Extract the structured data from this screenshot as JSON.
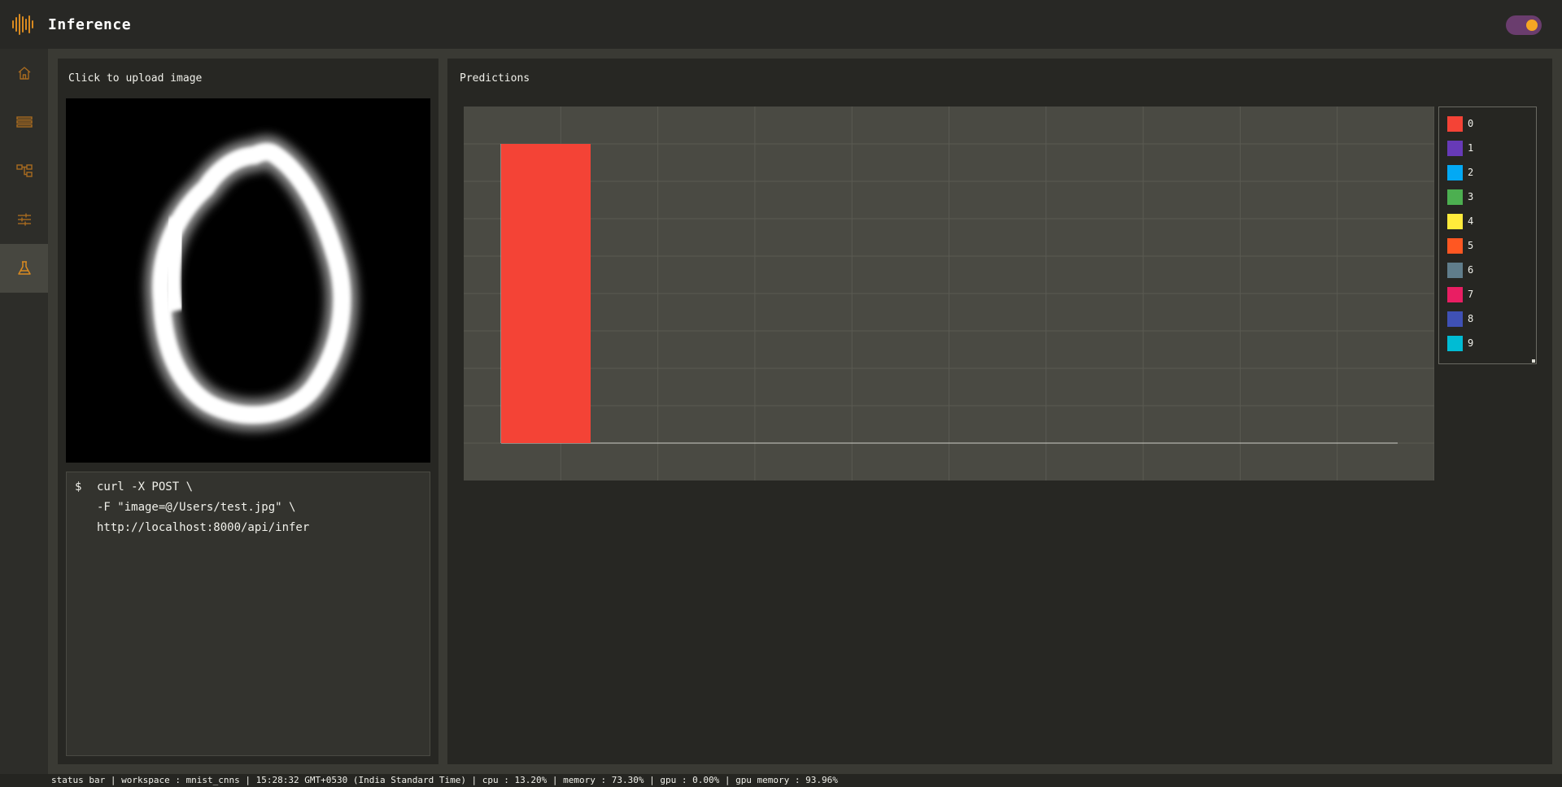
{
  "header": {
    "title": "Inference",
    "theme_toggle_on": true
  },
  "sidebar": {
    "items": [
      {
        "icon": "home-icon"
      },
      {
        "icon": "list-icon"
      },
      {
        "icon": "hierarchy-icon"
      },
      {
        "icon": "sliders-icon"
      },
      {
        "icon": "flask-icon",
        "active": true
      }
    ]
  },
  "upload": {
    "title": "Click to upload image",
    "terminal": {
      "prompt": "$",
      "lines": [
        "curl -X POST \\",
        "-F \"image=@/Users/test.jpg\" \\",
        "http://localhost:8000/api/infer"
      ]
    }
  },
  "predictions": {
    "title": "Predictions"
  },
  "chart_data": {
    "type": "bar",
    "categories": [
      "0",
      "1",
      "2",
      "3",
      "4",
      "5",
      "6",
      "7",
      "8",
      "9"
    ],
    "values": [
      1.0,
      0,
      0,
      0,
      0,
      0,
      0,
      0,
      0,
      0
    ],
    "colors": [
      "#f44336",
      "#673ab7",
      "#03a9f4",
      "#4caf50",
      "#ffeb3b",
      "#ff5722",
      "#607d8b",
      "#e91e63",
      "#3f51b5",
      "#00bcd4"
    ],
    "ylim": [
      0,
      1
    ],
    "grid": true,
    "legend_position": "right",
    "legend": [
      "0",
      "1",
      "2",
      "3",
      "4",
      "5",
      "6",
      "7",
      "8",
      "9"
    ]
  },
  "status_bar": {
    "text": "status bar | workspace : mnist_cnns | 15:28:32 GMT+0530 (India Standard Time) | cpu : 13.20% | memory : 73.30% | gpu : 0.00% | gpu memory : 93.96%"
  },
  "colors": {
    "accent": "#c8821e",
    "background": "#252521",
    "panel": "#272723"
  }
}
